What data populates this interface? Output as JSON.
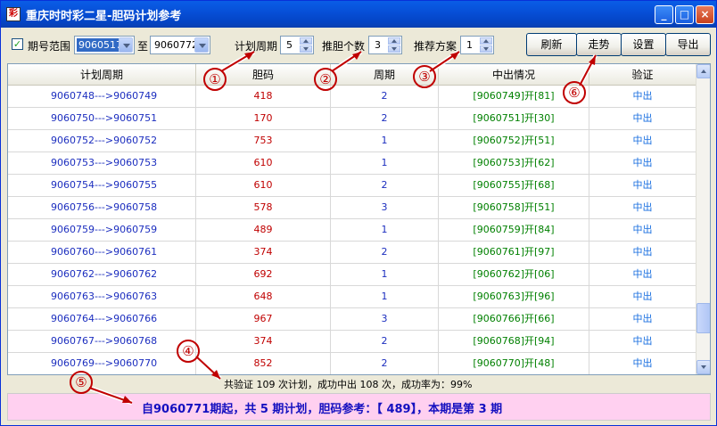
{
  "window": {
    "title": "重庆时时彩二星-胆码计划参考",
    "icon_text": "彩",
    "controls": {
      "minimize": "_",
      "maximize": "□",
      "close": "×"
    }
  },
  "toolbar": {
    "range_checkbox_checked": true,
    "range_label": "期号范围",
    "range_from": "9060517",
    "to_label": "至",
    "range_to": "9060772",
    "period_label": "计划周期",
    "period_value": "5",
    "count_label": "推胆个数",
    "count_value": "3",
    "scheme_label": "推荐方案",
    "scheme_value": "1",
    "buttons": {
      "refresh": "刷新",
      "trend": "走势",
      "settings": "设置",
      "export": "导出"
    }
  },
  "table": {
    "headers": [
      "计划周期",
      "胆码",
      "周期",
      "中出情况",
      "验证"
    ],
    "rows": [
      [
        "9060748--->9060749",
        "418",
        "2",
        "[9060749]开[81]",
        "中出"
      ],
      [
        "9060750--->9060751",
        "170",
        "2",
        "[9060751]开[30]",
        "中出"
      ],
      [
        "9060752--->9060752",
        "753",
        "1",
        "[9060752]开[51]",
        "中出"
      ],
      [
        "9060753--->9060753",
        "610",
        "1",
        "[9060753]开[62]",
        "中出"
      ],
      [
        "9060754--->9060755",
        "610",
        "2",
        "[9060755]开[68]",
        "中出"
      ],
      [
        "9060756--->9060758",
        "578",
        "3",
        "[9060758]开[51]",
        "中出"
      ],
      [
        "9060759--->9060759",
        "489",
        "1",
        "[9060759]开[84]",
        "中出"
      ],
      [
        "9060760--->9060761",
        "374",
        "2",
        "[9060761]开[97]",
        "中出"
      ],
      [
        "9060762--->9060762",
        "692",
        "1",
        "[9060762]开[06]",
        "中出"
      ],
      [
        "9060763--->9060763",
        "648",
        "1",
        "[9060763]开[96]",
        "中出"
      ],
      [
        "9060764--->9060766",
        "967",
        "3",
        "[9060766]开[66]",
        "中出"
      ],
      [
        "9060767--->9060768",
        "374",
        "2",
        "[9060768]开[94]",
        "中出"
      ],
      [
        "9060769--->9060770",
        "852",
        "2",
        "[9060770]开[48]",
        "中出"
      ]
    ]
  },
  "summary": "共验证 109 次计划，成功中出 108 次，成功率为：99%",
  "bottom_text": "自9060771期起，共 5 期计划，胆码参考：【 489】，本期是第 3 期",
  "markers": [
    "①",
    "②",
    "③",
    "④",
    "⑤",
    "⑥"
  ],
  "colors": {
    "title_bar": "#0750d8",
    "marker": "#c00000",
    "period_text": "#1c2ebf",
    "code_text": "#c00000",
    "result_text": "#008000",
    "verify_text": "#1a6fe0",
    "bottom_bg": "#ffd0f0"
  }
}
